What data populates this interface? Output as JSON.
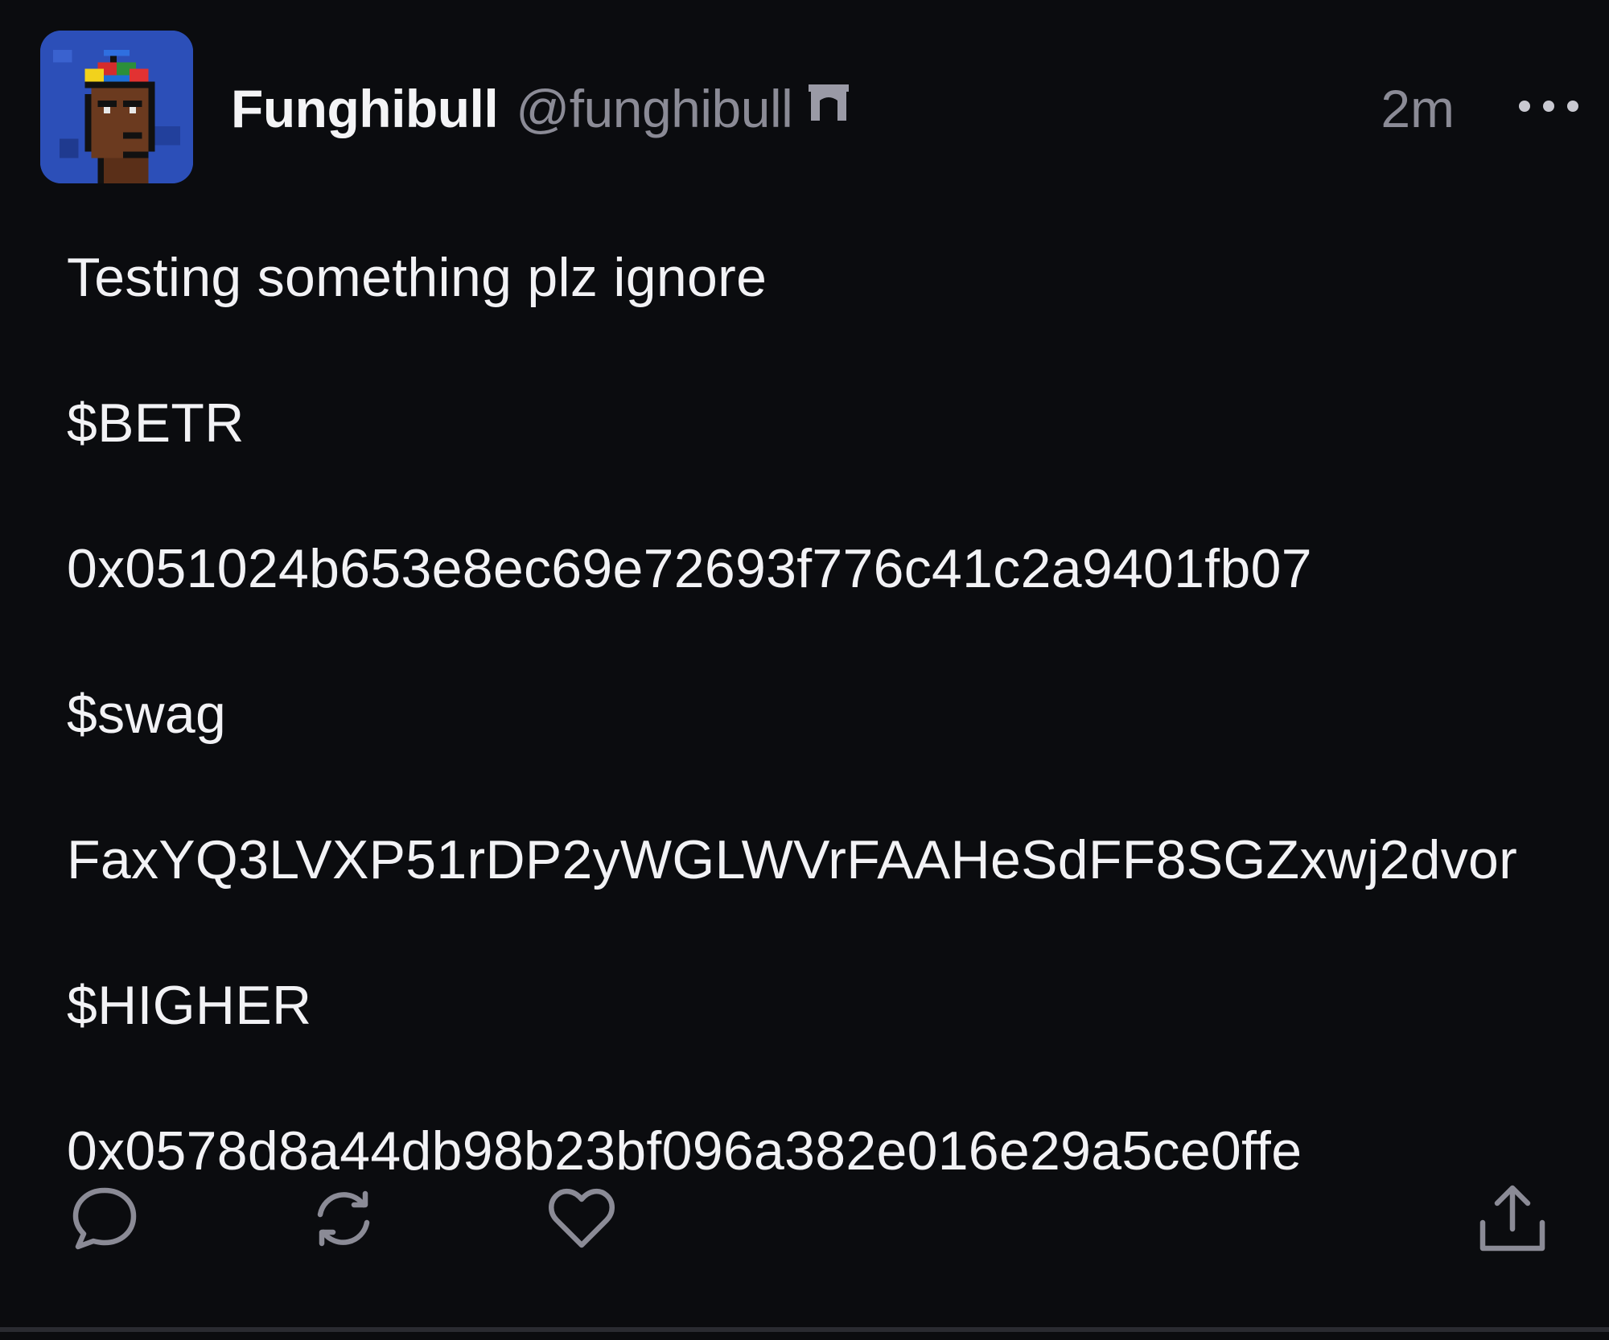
{
  "post": {
    "author": {
      "display_name": "Funghibull",
      "handle": "@funghibull",
      "avatar_icon": "pixel-punk-avatar",
      "badge_icon": "gateway-arch-icon"
    },
    "timestamp": "2m",
    "more_icon": "more-horizontal-icon",
    "lines": [
      "Testing something plz ignore",
      "$BETR",
      "0x051024b653e8ec69e72693f776c41c2a9401fb07",
      "$swag",
      "FaxYQ3LVXP51rDP2yWGLWVrFAAHeSdFF8SGZxwj2dvor",
      "$HIGHER",
      "0x0578d8a44db98b23bf096a382e016e29a5ce0ffe"
    ],
    "actions": {
      "reply_icon": "reply-bubble-icon",
      "recast_icon": "recast-arrows-icon",
      "like_icon": "heart-icon",
      "share_icon": "share-upload-icon"
    }
  },
  "colors": {
    "background": "#0b0c0f",
    "text_primary": "#f2f2f5",
    "text_secondary": "#8b8b96",
    "divider": "#2a2b31"
  }
}
